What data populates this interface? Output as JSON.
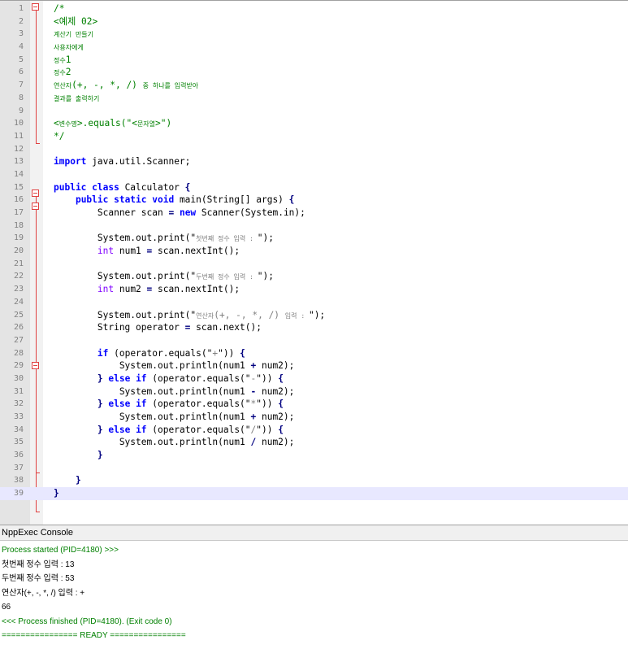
{
  "editor": {
    "current_line": 39,
    "lines": [
      {
        "n": "1",
        "segments": [
          {
            "t": "/*",
            "c": "comment"
          }
        ]
      },
      {
        "n": "2",
        "segments": [
          {
            "t": "<예제 02>",
            "c": "comment"
          }
        ]
      },
      {
        "n": "3",
        "segments": [
          {
            "t": "계산기 만들기",
            "c": "comment small"
          }
        ]
      },
      {
        "n": "4",
        "segments": [
          {
            "t": "사용자에게",
            "c": "comment small"
          }
        ]
      },
      {
        "n": "5",
        "segments": [
          {
            "t": "정수",
            "c": "comment small"
          },
          {
            "t": "1",
            "c": "comment"
          }
        ]
      },
      {
        "n": "6",
        "segments": [
          {
            "t": "정수",
            "c": "comment small"
          },
          {
            "t": "2",
            "c": "comment"
          }
        ]
      },
      {
        "n": "7",
        "segments": [
          {
            "t": "연산자",
            "c": "comment small"
          },
          {
            "t": "(+, -, *, /) ",
            "c": "comment"
          },
          {
            "t": "중 하나를 입력받아",
            "c": "comment small"
          }
        ]
      },
      {
        "n": "8",
        "segments": [
          {
            "t": "결과를 출력하기",
            "c": "comment small"
          }
        ]
      },
      {
        "n": "9",
        "segments": []
      },
      {
        "n": "10",
        "segments": [
          {
            "t": "<",
            "c": "comment"
          },
          {
            "t": "변수명",
            "c": "comment small"
          },
          {
            "t": ">.equals(\"<",
            "c": "comment"
          },
          {
            "t": "문자열",
            "c": "comment small"
          },
          {
            "t": ">\")",
            "c": "comment"
          }
        ]
      },
      {
        "n": "11",
        "segments": [
          {
            "t": "*/",
            "c": "comment"
          }
        ]
      },
      {
        "n": "12",
        "segments": []
      },
      {
        "n": "13",
        "segments": [
          {
            "t": "import",
            "c": "kw"
          },
          {
            "t": " java.util.Scanner;",
            "c": ""
          }
        ]
      },
      {
        "n": "14",
        "segments": []
      },
      {
        "n": "15",
        "segments": [
          {
            "t": "public class",
            "c": "kw"
          },
          {
            "t": " Calculator ",
            "c": ""
          },
          {
            "t": "{",
            "c": "op"
          }
        ]
      },
      {
        "n": "16",
        "segments": [
          {
            "t": "    ",
            "c": ""
          },
          {
            "t": "public static void",
            "c": "kw"
          },
          {
            "t": " main(String[] args) ",
            "c": ""
          },
          {
            "t": "{",
            "c": "op"
          }
        ]
      },
      {
        "n": "17",
        "segments": [
          {
            "t": "        Scanner scan ",
            "c": ""
          },
          {
            "t": "=",
            "c": "op"
          },
          {
            "t": " ",
            "c": ""
          },
          {
            "t": "new",
            "c": "kw"
          },
          {
            "t": " Scanner(System.in);",
            "c": ""
          }
        ]
      },
      {
        "n": "18",
        "segments": []
      },
      {
        "n": "19",
        "segments": [
          {
            "t": "        System.out.print(\"",
            "c": ""
          },
          {
            "t": "첫번째 정수 입력 : ",
            "c": "str small"
          },
          {
            "t": "\");",
            "c": ""
          }
        ]
      },
      {
        "n": "20",
        "segments": [
          {
            "t": "        ",
            "c": ""
          },
          {
            "t": "int",
            "c": "type"
          },
          {
            "t": " num1 ",
            "c": ""
          },
          {
            "t": "=",
            "c": "op"
          },
          {
            "t": " scan.nextInt();",
            "c": ""
          }
        ]
      },
      {
        "n": "21",
        "segments": []
      },
      {
        "n": "22",
        "segments": [
          {
            "t": "        System.out.print(\"",
            "c": ""
          },
          {
            "t": "두번째 정수 입력 : ",
            "c": "str small"
          },
          {
            "t": "\");",
            "c": ""
          }
        ]
      },
      {
        "n": "23",
        "segments": [
          {
            "t": "        ",
            "c": ""
          },
          {
            "t": "int",
            "c": "type"
          },
          {
            "t": " num2 ",
            "c": ""
          },
          {
            "t": "=",
            "c": "op"
          },
          {
            "t": " scan.nextInt();",
            "c": ""
          }
        ]
      },
      {
        "n": "24",
        "segments": []
      },
      {
        "n": "25",
        "segments": [
          {
            "t": "        System.out.print(\"",
            "c": ""
          },
          {
            "t": "연산자",
            "c": "str small"
          },
          {
            "t": "(+, -, *, /) ",
            "c": "str"
          },
          {
            "t": "입력 : ",
            "c": "str small"
          },
          {
            "t": "\");",
            "c": ""
          }
        ]
      },
      {
        "n": "26",
        "segments": [
          {
            "t": "        String operator ",
            "c": ""
          },
          {
            "t": "=",
            "c": "op"
          },
          {
            "t": " scan.next();",
            "c": ""
          }
        ]
      },
      {
        "n": "27",
        "segments": []
      },
      {
        "n": "28",
        "segments": [
          {
            "t": "        ",
            "c": ""
          },
          {
            "t": "if",
            "c": "kw"
          },
          {
            "t": " (operator.equals(\"",
            "c": ""
          },
          {
            "t": "+",
            "c": "str"
          },
          {
            "t": "\")) ",
            "c": ""
          },
          {
            "t": "{",
            "c": "op"
          }
        ]
      },
      {
        "n": "29",
        "segments": [
          {
            "t": "            System.out.println(num1 ",
            "c": ""
          },
          {
            "t": "+",
            "c": "op"
          },
          {
            "t": " num2);",
            "c": ""
          }
        ]
      },
      {
        "n": "30",
        "segments": [
          {
            "t": "        ",
            "c": ""
          },
          {
            "t": "}",
            "c": "op"
          },
          {
            "t": " ",
            "c": ""
          },
          {
            "t": "else if",
            "c": "kw"
          },
          {
            "t": " (operator.equals(\"",
            "c": ""
          },
          {
            "t": "-",
            "c": "str"
          },
          {
            "t": "\")) ",
            "c": ""
          },
          {
            "t": "{",
            "c": "op"
          }
        ]
      },
      {
        "n": "31",
        "segments": [
          {
            "t": "            System.out.println(num1 ",
            "c": ""
          },
          {
            "t": "-",
            "c": "op"
          },
          {
            "t": " num2);",
            "c": ""
          }
        ]
      },
      {
        "n": "32",
        "segments": [
          {
            "t": "        ",
            "c": ""
          },
          {
            "t": "}",
            "c": "op"
          },
          {
            "t": " ",
            "c": ""
          },
          {
            "t": "else if",
            "c": "kw"
          },
          {
            "t": " (operator.equals(\"",
            "c": ""
          },
          {
            "t": "*",
            "c": "str"
          },
          {
            "t": "\")) ",
            "c": ""
          },
          {
            "t": "{",
            "c": "op"
          }
        ]
      },
      {
        "n": "33",
        "segments": [
          {
            "t": "            System.out.println(num1 ",
            "c": ""
          },
          {
            "t": "+",
            "c": "op"
          },
          {
            "t": " num2);",
            "c": ""
          }
        ]
      },
      {
        "n": "34",
        "segments": [
          {
            "t": "        ",
            "c": ""
          },
          {
            "t": "}",
            "c": "op"
          },
          {
            "t": " ",
            "c": ""
          },
          {
            "t": "else if",
            "c": "kw"
          },
          {
            "t": " (operator.equals(\"",
            "c": ""
          },
          {
            "t": "/",
            "c": "str"
          },
          {
            "t": "\")) ",
            "c": ""
          },
          {
            "t": "{",
            "c": "op"
          }
        ]
      },
      {
        "n": "35",
        "segments": [
          {
            "t": "            System.out.println(num1 ",
            "c": ""
          },
          {
            "t": "/",
            "c": "op"
          },
          {
            "t": " num2);",
            "c": ""
          }
        ]
      },
      {
        "n": "36",
        "segments": [
          {
            "t": "        ",
            "c": ""
          },
          {
            "t": "}",
            "c": "op"
          }
        ]
      },
      {
        "n": "37",
        "segments": []
      },
      {
        "n": "38",
        "segments": [
          {
            "t": "    ",
            "c": ""
          },
          {
            "t": "}",
            "c": "op"
          }
        ]
      },
      {
        "n": "39",
        "segments": [
          {
            "t": "}",
            "c": "op"
          }
        ]
      }
    ]
  },
  "console": {
    "title": "NppExec Console",
    "lines": [
      {
        "text": "Process started (PID=4180) >>>",
        "color": "green"
      },
      {
        "text": "첫번째 정수 입력 : 13",
        "color": "black"
      },
      {
        "text": "두번째 정수 입력 : 53",
        "color": "black"
      },
      {
        "text": "연산자(+, -, *, /) 입력 : +",
        "color": "black"
      },
      {
        "text": "66",
        "color": "black"
      },
      {
        "text": "<<< Process finished (PID=4180). (Exit code 0)",
        "color": "green"
      },
      {
        "text": "================ READY ================",
        "color": "green"
      }
    ]
  }
}
